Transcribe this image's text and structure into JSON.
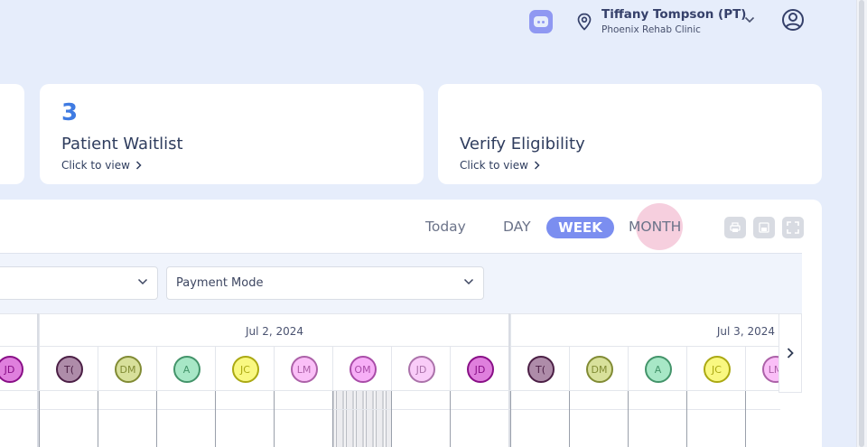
{
  "header": {
    "user_name": "Tiffany Tompson (PT)",
    "clinic_name": "Phoenix Rehab Clinic"
  },
  "cards": {
    "waitlist": {
      "count": "3",
      "title": "Patient Waitlist",
      "link": "Click to view"
    },
    "verify": {
      "title": "Verify Eligibility",
      "link": "Click to view"
    }
  },
  "calendar": {
    "views": {
      "today": "Today",
      "day": "DAY",
      "week": "WEEK",
      "month": "MONTH"
    },
    "active_view": "WEEK",
    "filters": {
      "payment_mode": "Payment Mode"
    },
    "dates": [
      "Jul 2, 2024",
      "Jul 3, 2024"
    ],
    "avatars_prev": [
      {
        "initials": "JD",
        "color": "#c416c1"
      }
    ],
    "avatars_jul2": [
      {
        "initials": "T(",
        "color": "#6b2d63"
      },
      {
        "initials": "DM",
        "color": "#b8c74a"
      },
      {
        "initials": "A",
        "color": "#5fd497"
      },
      {
        "initials": "JC",
        "color": "#f4f21a"
      },
      {
        "initials": "LM",
        "color": "#f58af0"
      },
      {
        "initials": "OM",
        "color": "#f16df0"
      },
      {
        "initials": "JD",
        "color": "#f4a3f3"
      },
      {
        "initials": "JD",
        "color": "#c416c1"
      }
    ],
    "avatars_jul3": [
      {
        "initials": "T(",
        "color": "#6b2d63"
      },
      {
        "initials": "DM",
        "color": "#b8c74a"
      },
      {
        "initials": "A",
        "color": "#5fd497"
      },
      {
        "initials": "JC",
        "color": "#f4f21a"
      },
      {
        "initials": "LM",
        "color": "#f58af0"
      }
    ]
  },
  "colors": {
    "accent": "#7b8ef0",
    "count": "#3f7be2",
    "background": "#e6edfb"
  },
  "icons": {
    "chat": "chat-icon",
    "location": "location-pin-icon",
    "dropdown": "chevron-down-icon",
    "account": "account-circle-icon",
    "print": "print-icon",
    "save": "save-icon",
    "fullscreen": "fullscreen-icon",
    "next": "chevron-right-icon"
  }
}
